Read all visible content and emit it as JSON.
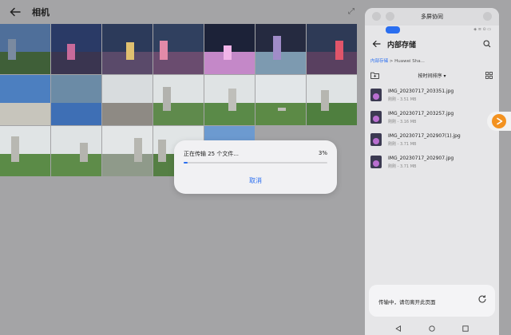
{
  "gallery": {
    "title": "相机",
    "corner_glyph": "⤢"
  },
  "dialog": {
    "message": "正在传输 25 个文件...",
    "percent_text": "3%",
    "progress": 0.03,
    "cancel_label": "取消",
    "accent": "#2a6ef0"
  },
  "panel": {
    "title": "多屏协同",
    "mini_status": "◈ ≡ ⊙ ▭",
    "heading": "内部存储",
    "breadcrumb": {
      "first": "内部存储",
      "separator": ">",
      "second": "Huawei Sha..."
    },
    "sort_label": "按时间排序",
    "files": [
      {
        "name": "IMG_20230717_203351.jpg",
        "meta": "刚刚 - 3.51 MB"
      },
      {
        "name": "IMG_20230717_203257.jpg",
        "meta": "刚刚 - 3.16 MB"
      },
      {
        "name": "IMG_20230717_202907(1).jpg",
        "meta": "刚刚 - 3.71 MB"
      },
      {
        "name": "IMG_20230717_202907.jpg",
        "meta": "刚刚 - 3.71 MB"
      }
    ],
    "status_text": "传输中，请勿离开此页面"
  },
  "icons": {
    "back": "back-arrow-icon",
    "search": "search-icon",
    "grid": "grid-view-icon",
    "add_folder": "add-folder-icon",
    "refresh": "refresh-icon",
    "close": "close-icon",
    "minimize": "minimize-icon",
    "expand": "expand-icon"
  }
}
